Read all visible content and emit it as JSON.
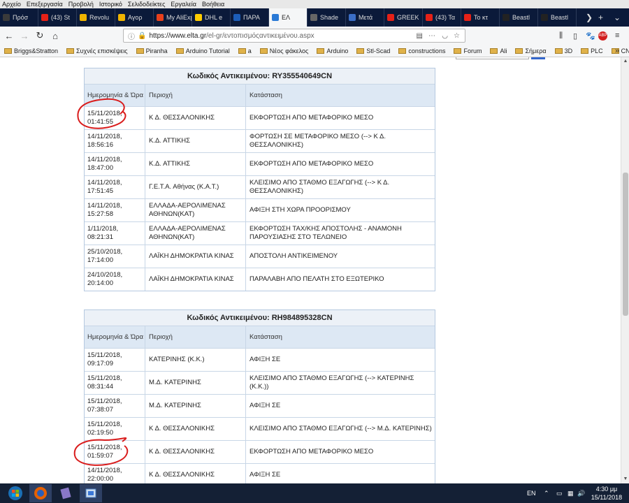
{
  "menubar": [
    "Αρχείο",
    "Επεξεργασία",
    "Προβολή",
    "Ιστορικό",
    "Σελιδοδείκτες",
    "Εργαλεία",
    "Βοήθεια"
  ],
  "tabs": [
    {
      "label": "Πρόσ",
      "color": "#3a3a3a"
    },
    {
      "label": "(43) St",
      "color": "#e62117"
    },
    {
      "label": "Revolu",
      "color": "#f0b400"
    },
    {
      "label": "Αγορ",
      "color": "#f0b400"
    },
    {
      "label": "My AliExp",
      "color": "#e8401c"
    },
    {
      "label": "DHL e",
      "color": "#ffcc00"
    },
    {
      "label": "ΠΑΡΑ",
      "color": "#1c5db8"
    },
    {
      "label": "ΕΛ",
      "color": "#2a7ad6",
      "active": true
    },
    {
      "label": "Shade",
      "color": "#666"
    },
    {
      "label": "Μετά",
      "color": "#3b6ec6"
    },
    {
      "label": "GREEK",
      "color": "#e62117"
    },
    {
      "label": "(43) Τα",
      "color": "#e62117"
    },
    {
      "label": "Το κτ",
      "color": "#e62117"
    },
    {
      "label": "Beastl",
      "color": "#222"
    },
    {
      "label": "Beastl",
      "color": "#222"
    }
  ],
  "url": {
    "host": "https://www.elta.gr",
    "path": "/el-gr/εντοπισμόςαντικειμένου.aspx"
  },
  "bookmarks": [
    "Briggs&Stratton",
    "Συχνές επισκέψεις",
    "Piranha",
    "Arduino Tutorial",
    "a",
    "Νέος φάκελος",
    "Arduino",
    "Stl-Scad",
    "constructions",
    "Forum",
    "Ali",
    "Σήμερα",
    "3D",
    "PLC",
    "CNC"
  ],
  "tracking": [
    {
      "title": "Κωδικός Αντικειμένου: RY355540649CN",
      "headers": [
        "Ημερομηνία & Ώρα",
        "Περιοχή",
        "Κατάσταση"
      ],
      "rows": [
        {
          "date": "15/11/2018,",
          "time": "01:41:55",
          "area": "Κ Δ. ΘΕΣΣΑΛΟΝΙΚΗΣ",
          "status": "ΕΚΦΟΡΤΩΣΗ ΑΠΟ ΜΕΤΑΦΟΡΙΚΟ ΜΕΣΟ"
        },
        {
          "date": "14/11/2018,",
          "time": "18:56:16",
          "area": "Κ.Δ. ΑΤΤΙΚΗΣ",
          "status": "ΦΟΡΤΩΣΗ ΣΕ ΜΕΤΑΦΟΡΙΚΟ ΜΕΣΟ (--> Κ Δ. ΘΕΣΣΑΛΟΝΙΚΗΣ)"
        },
        {
          "date": "14/11/2018,",
          "time": "18:47:00",
          "area": "Κ.Δ. ΑΤΤΙΚΗΣ",
          "status": "ΕΚΦΟΡΤΩΣΗ ΑΠΟ ΜΕΤΑΦΟΡΙΚΟ ΜΕΣΟ"
        },
        {
          "date": "14/11/2018,",
          "time": "17:51:45",
          "area": "Γ.Ε.Τ.Α. Αθήνας (Κ.Α.Τ.)",
          "status": "ΚΛΕΙΣΙΜΟ ΑΠΟ ΣΤΑΘΜΟ ΕΞΑΓΩΓΗΣ (--> Κ Δ. ΘΕΣΣΑΛΟΝΙΚΗΣ)"
        },
        {
          "date": "14/11/2018,",
          "time": "15:27:58",
          "area": "ΕΛΛΑΔΑ-ΑΕΡΟΛΙΜΕΝΑΣ ΑΘΗΝΩΝ(ΚΑΤ)",
          "status": "ΑΦΙΞΗ ΣΤΗ ΧΩΡΑ ΠΡΟΟΡΙΣΜΟΥ"
        },
        {
          "date": "1/11/2018,",
          "time": "08:21:31",
          "area": "ΕΛΛΑΔΑ-ΑΕΡΟΛΙΜΕΝΑΣ ΑΘΗΝΩΝ(ΚΑΤ)",
          "status": "ΕΚΦΟΡΤΩΣΗ ΤΑΧ/ΚΗΣ ΑΠΟΣΤΟΛΗΣ - ΑΝΑΜΟΝΗ ΠΑΡΟΥΣΙΑΣΗΣ ΣΤΟ ΤΕΛΩΝΕΙΟ"
        },
        {
          "date": "25/10/2018,",
          "time": "17:14:00",
          "area": "ΛΑΪΚΗ ΔΗΜΟΚΡΑΤΙΑ ΚΙΝΑΣ",
          "status": "ΑΠΟΣΤΟΛΗ ΑΝΤΙΚΕΙΜΕΝΟΥ"
        },
        {
          "date": "24/10/2018,",
          "time": "20:14:00",
          "area": "ΛΑΪΚΗ ΔΗΜΟΚΡΑΤΙΑ ΚΙΝΑΣ",
          "status": "ΠΑΡΑΛΑΒΗ ΑΠΟ ΠΕΛΑΤΗ ΣΤΟ ΕΞΩΤΕΡΙΚΟ"
        }
      ]
    },
    {
      "title": "Κωδικός Αντικειμένου: RH984895328CN",
      "headers": [
        "Ημερομηνία & Ώρα",
        "Περιοχή",
        "Κατάσταση"
      ],
      "rows": [
        {
          "date": "15/11/2018,",
          "time": "09:17:09",
          "area": "ΚΑΤΕΡΙΝΗΣ (Κ.Κ.)",
          "status": "ΑΦΙΞΗ ΣΕ"
        },
        {
          "date": "15/11/2018,",
          "time": "08:31:44",
          "area": "Μ.Δ. ΚΑΤΕΡΙΝΗΣ",
          "status": "ΚΛΕΙΣΙΜΟ ΑΠΟ ΣΤΑΘΜΟ ΕΞΑΓΩΓΗΣ (--> ΚΑΤΕΡΙΝΗΣ (Κ.Κ.))"
        },
        {
          "date": "15/11/2018,",
          "time": "07:38:07",
          "area": "Μ.Δ. ΚΑΤΕΡΙΝΗΣ",
          "status": "ΑΦΙΞΗ ΣΕ"
        },
        {
          "date": "15/11/2018,",
          "time": "02:19:50",
          "area": "Κ Δ. ΘΕΣΣΑΛΟΝΙΚΗΣ",
          "status": "ΚΛΕΙΣΙΜΟ ΑΠΟ ΣΤΑΘΜΟ ΕΞΑΓΩΓΗΣ (--> Μ.Δ. ΚΑΤΕΡΙΝΗΣ)"
        },
        {
          "date": "15/11/2018,",
          "time": "01:59:07",
          "area": "Κ Δ. ΘΕΣΣΑΛΟΝΙΚΗΣ",
          "status": "ΕΚΦΟΡΤΩΣΗ ΑΠΟ ΜΕΤΑΦΟΡΙΚΟ ΜΕΣΟ"
        },
        {
          "date": "14/11/2018,",
          "time": "22:00:00",
          "area": "Κ Δ. ΘΕΣΣΑΛΟΝΙΚΗΣ",
          "status": "ΑΦΙΞΗ ΣΕ"
        }
      ]
    }
  ],
  "taskbar": {
    "lang": "EN",
    "time": "4:30 μμ",
    "date": "15/11/2018"
  },
  "accent_colors": {
    "table_border": "#b5c9e0",
    "header_bg": "#dde8f4",
    "circle": "#d91c1c"
  }
}
